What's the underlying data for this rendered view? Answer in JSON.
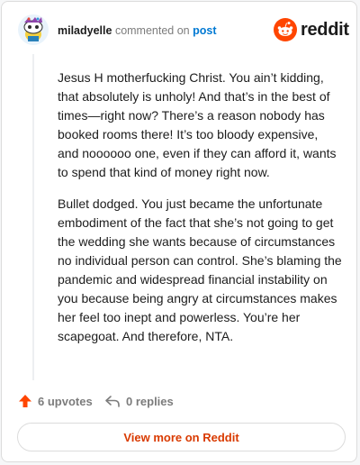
{
  "header": {
    "username": "miladyelle",
    "action_text": "commented on",
    "post_link": "post",
    "brand_name": "reddit"
  },
  "comment": {
    "paragraphs": [
      "Jesus H motherfucking Christ. You ain’t kidding, that absolutely is unholy! And that’s in the best of times—right now? There’s a reason nobody has booked rooms there! It’s too bloody expensive, and noooooo one, even if they can afford it, wants to spend that kind of money right now.",
      "Bullet dodged. You just became the unfortunate embodiment of the fact that she’s not going to get the wedding she wants because of circumstances no individual person can control. She’s blaming the pandemic and widespread financial instability on you because being angry at circumstances makes her feel too inept and powerless. You’re her scapegoat. And therefore, NTA."
    ]
  },
  "actions": {
    "upvotes_label": "6 upvotes",
    "replies_label": "0 replies"
  },
  "footer": {
    "view_more_label": "View more on Reddit"
  },
  "colors": {
    "brand": "#ff4500",
    "link": "#0079d3",
    "view_more": "#d93a00"
  },
  "icons": {
    "upvote": "upvote-arrow-icon",
    "reply": "reply-arrow-icon",
    "brand": "reddit-snoo-icon"
  }
}
